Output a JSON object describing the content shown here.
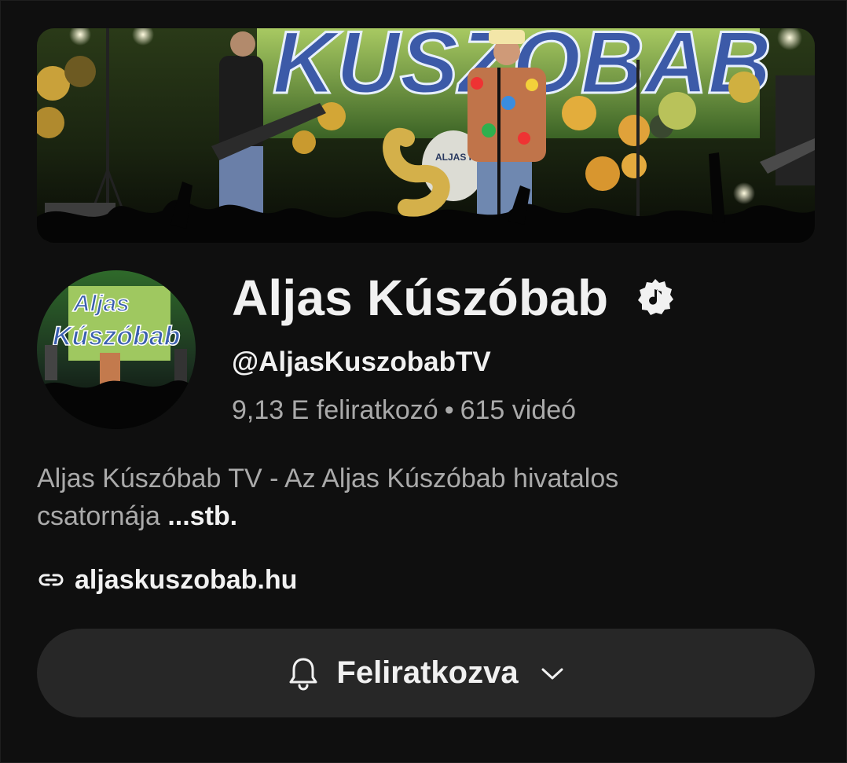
{
  "banner": {
    "image_text": "KÚSZÓBAB",
    "drum_text": "ALJAS KÚSZÓBAB"
  },
  "avatar": {
    "logo_line1": "Aljas",
    "logo_line2": "Kúszóbab"
  },
  "channel": {
    "name": "Aljas Kúszóbab",
    "verified_icon": "music-note-verified-icon",
    "handle": "@AljasKuszobabTV",
    "subscribers": "9,13 E feliratkozó",
    "separator": "•",
    "videos": "615 videó"
  },
  "description": {
    "text": "Aljas Kúszóbab TV - Az Aljas Kúszóbab hivatalos csatornája ",
    "more_label": "...stb."
  },
  "link": {
    "icon": "link-icon",
    "url_text": "aljaskuszobab.hu"
  },
  "subscribe": {
    "bell_icon": "bell-icon",
    "label": "Feliratkozva",
    "chevron_icon": "chevron-down-icon"
  },
  "colors": {
    "background": "#0f0f0f",
    "primary_text": "#f1f1f1",
    "secondary_text": "#aaaaaa",
    "button_bg": "#272727"
  }
}
